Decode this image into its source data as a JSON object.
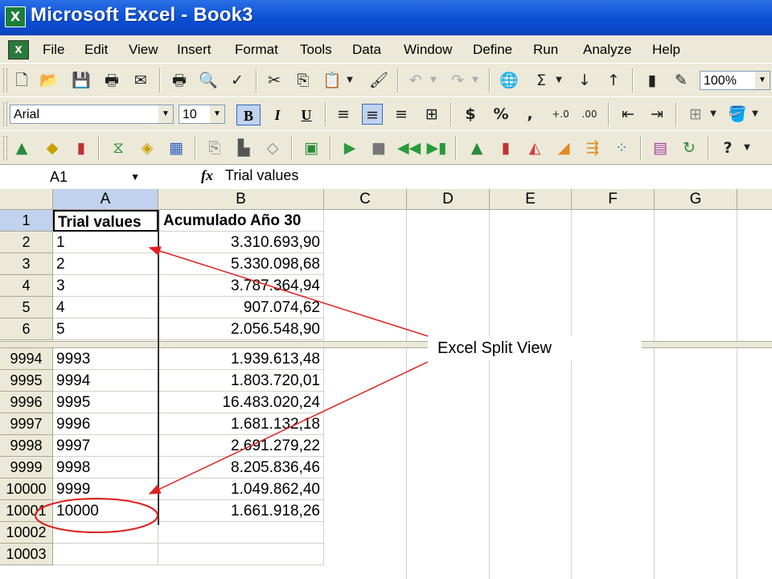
{
  "app": {
    "title": "Microsoft Excel - Book3"
  },
  "menu": [
    "File",
    "Edit",
    "View",
    "Insert",
    "Format",
    "Tools",
    "Data",
    "Window",
    "Define",
    "Run",
    "Analyze",
    "Help"
  ],
  "toolbar": {
    "zoom": "100%",
    "font_name": "Arial",
    "font_size": "10",
    "bold": "B",
    "italic": "I",
    "underline": "U"
  },
  "formula_bar": {
    "cell_ref": "A1",
    "fx": "fx",
    "value": "Trial values"
  },
  "sheet": {
    "columns": [
      "A",
      "B",
      "C",
      "D",
      "E",
      "F",
      "G"
    ],
    "selected_column": "A",
    "top_rows": [
      {
        "row": "1",
        "a": "Trial values",
        "b": "Acumulado Año 30"
      },
      {
        "row": "2",
        "a": "1",
        "b": "3.310.693,90"
      },
      {
        "row": "3",
        "a": "2",
        "b": "5.330.098,68"
      },
      {
        "row": "4",
        "a": "3",
        "b": "3.787.364,94"
      },
      {
        "row": "5",
        "a": "4",
        "b": "907.074,62"
      },
      {
        "row": "6",
        "a": "5",
        "b": "2.056.548,90"
      }
    ],
    "bottom_rows": [
      {
        "row": "9994",
        "a": "9993",
        "b": "1.939.613,48"
      },
      {
        "row": "9995",
        "a": "9994",
        "b": "1.803.720,01"
      },
      {
        "row": "9996",
        "a": "9995",
        "b": "16.483.020,24"
      },
      {
        "row": "9997",
        "a": "9996",
        "b": "1.681.132,18"
      },
      {
        "row": "9998",
        "a": "9997",
        "b": "2.691.279,22"
      },
      {
        "row": "9999",
        "a": "9998",
        "b": "8.205.836,46"
      },
      {
        "row": "10000",
        "a": "9999",
        "b": "1.049.862,40"
      },
      {
        "row": "10001",
        "a": "10000",
        "b": "1.661.918,26"
      },
      {
        "row": "10002",
        "a": "",
        "b": ""
      },
      {
        "row": "10003",
        "a": "",
        "b": ""
      }
    ]
  },
  "annotation": {
    "callout": "Excel Split View",
    "color": "#e02020"
  },
  "colors": {
    "title_bar": "#0a4fd2",
    "chrome": "#ece9d8",
    "selection": "#c1d2ee"
  }
}
